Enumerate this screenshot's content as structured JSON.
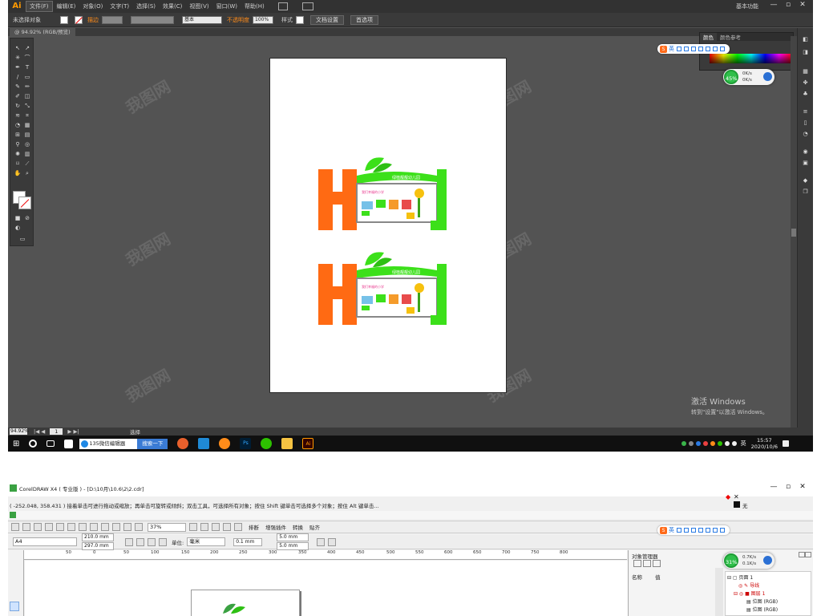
{
  "illustrator": {
    "logo": "Ai",
    "menus": [
      "文件(F)",
      "编辑(E)",
      "对象(O)",
      "文字(T)",
      "选择(S)",
      "效果(C)",
      "视图(V)",
      "窗口(W)",
      "帮助(H)"
    ],
    "workspace_label": "基本功能",
    "window_buttons": [
      "—",
      "▫",
      "✕"
    ],
    "control_bar": {
      "selection_label": "未选择对象",
      "stroke_label": "描边",
      "stroke_style": "基本",
      "opacity_label": "不透明度",
      "opacity_value": "100%",
      "style_label": "样式",
      "doc_setup_button": "文档设置",
      "preferences_button": "首选项"
    },
    "doc_tab": "@ 94.92% (RGB/预览)",
    "color_panel": {
      "tab_color": "颜色",
      "tab_color_guide": "颜色参考"
    },
    "ime_bar": {
      "lang": "英"
    },
    "net_widget": {
      "percent": "45%",
      "up": "0K/s",
      "down": "0K/s"
    },
    "status": {
      "zoom": "94.92%",
      "page": "1",
      "tool": "选择"
    },
    "windows_watermark": {
      "title": "激活 Windows",
      "subtitle": "转到\"设置\"以激活 Windows。"
    },
    "artboard_design": {
      "top": {
        "banner_text": "绿植靓靓幼儿园",
        "inner_title": "我们幸福的小学"
      },
      "bottom": {
        "banner_text": "绿植靓靓幼儿园",
        "inner_title": "我们幸福的小学"
      }
    }
  },
  "taskbar": {
    "search_text": "135微信编辑器",
    "search_button": "搜索一下",
    "tray_lang": "英",
    "time": "15:57",
    "date": "2020/10/6",
    "ai_app_label": "Ai",
    "ps_app_label": "Ps"
  },
  "coreldraw": {
    "title": "CorelDRAW X4 ( 专业版 ) - [D:\\10月\\10.6\\2\\2.cdr]",
    "status": "( -252.048, 358.431 )   接着单击可进行拖动或缩放；再单击可旋转或倾斜；双击工具，可选择所有对象；按住 Shift 键单击可选择多个对象；按住 Alt 键单击...",
    "color_indicator_none": "无",
    "zoom_value": "37%",
    "toolbar_buttons": [
      "排断",
      "增强插件",
      "转换",
      "贴齐"
    ],
    "paper_size": "A4",
    "width": "210.0 mm",
    "height": "297.0 mm",
    "unit_label": "单位:",
    "unit_value": "毫米",
    "nudge": "0.1 mm",
    "dup_x": "5.0 mm",
    "dup_y": "5.0 mm",
    "ruler_ticks": [
      "50",
      "0",
      "50",
      "100",
      "150",
      "200",
      "250",
      "300",
      "350",
      "400",
      "450",
      "500",
      "550",
      "600",
      "650",
      "700",
      "750",
      "800"
    ],
    "object_manager": {
      "title": "对象管理器",
      "col_name": "名称",
      "col_value": "值",
      "page": "页面 1",
      "guides": "导线",
      "layer": "图层 1",
      "bitmap1": "位图 (RGB)",
      "bitmap2": "位图 (RGB)"
    },
    "net_widget": {
      "percent": "31%",
      "up": "0.7K/s",
      "down": "0.1K/s"
    }
  },
  "colors": {
    "orange": "#ff6a13",
    "green": "#3ce01a",
    "ai_bg": "#535353"
  }
}
